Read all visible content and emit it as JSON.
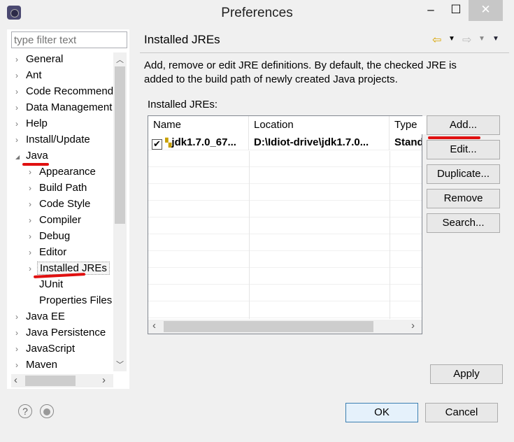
{
  "window": {
    "title": "Preferences",
    "minimize": "–",
    "maximize": "☐",
    "close": "✕"
  },
  "sidebar": {
    "filter_placeholder": "type filter text",
    "items": [
      {
        "label": "General",
        "level": 0,
        "twisty": "›"
      },
      {
        "label": "Ant",
        "level": 0,
        "twisty": "›"
      },
      {
        "label": "Code Recommenders",
        "level": 0,
        "twisty": "›"
      },
      {
        "label": "Data Management",
        "level": 0,
        "twisty": "›"
      },
      {
        "label": "Help",
        "level": 0,
        "twisty": "›"
      },
      {
        "label": "Install/Update",
        "level": 0,
        "twisty": "›"
      },
      {
        "label": "Java",
        "level": 0,
        "twisty": "◢"
      },
      {
        "label": "Appearance",
        "level": 1,
        "twisty": "›"
      },
      {
        "label": "Build Path",
        "level": 1,
        "twisty": "›"
      },
      {
        "label": "Code Style",
        "level": 1,
        "twisty": "›"
      },
      {
        "label": "Compiler",
        "level": 1,
        "twisty": "›"
      },
      {
        "label": "Debug",
        "level": 1,
        "twisty": "›"
      },
      {
        "label": "Editor",
        "level": 1,
        "twisty": "›"
      },
      {
        "label": "Installed JREs",
        "level": 1,
        "twisty": "›",
        "selected": true
      },
      {
        "label": "JUnit",
        "level": 1,
        "twisty": ""
      },
      {
        "label": "Properties Files Editor",
        "level": 1,
        "twisty": ""
      },
      {
        "label": "Java EE",
        "level": 0,
        "twisty": "›"
      },
      {
        "label": "Java Persistence",
        "level": 0,
        "twisty": "›"
      },
      {
        "label": "JavaScript",
        "level": 0,
        "twisty": "›"
      },
      {
        "label": "Maven",
        "level": 0,
        "twisty": "›"
      }
    ]
  },
  "page": {
    "title": "Installed JREs",
    "description": "Add, remove or edit JRE definitions. By default, the checked JRE is added to the build path of newly created Java projects.",
    "table_label": "Installed JREs:",
    "columns": [
      "Name",
      "Location",
      "Type"
    ],
    "rows": [
      {
        "checked": true,
        "name": "jdk1.7.0_67...",
        "location": "D:\\Idiot-drive\\jdk1.7.0...",
        "type": "Standard VM"
      }
    ],
    "buttons": {
      "add": "Add...",
      "edit": "Edit...",
      "duplicate": "Duplicate...",
      "remove": "Remove",
      "search": "Search..."
    },
    "apply": "Apply"
  },
  "footer": {
    "ok": "OK",
    "cancel": "Cancel",
    "help": "?"
  },
  "annotation_color": "#e01010"
}
